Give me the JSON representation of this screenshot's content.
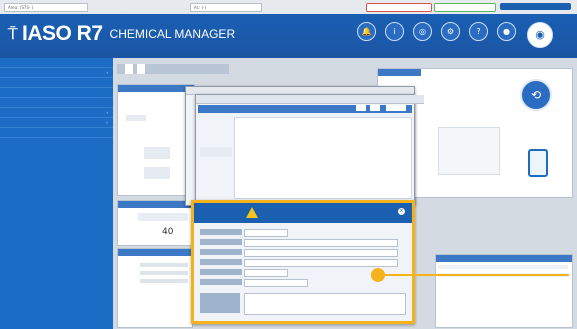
{
  "topbar": {
    "left_field": "Area: (STS- )",
    "middle_field": "Ac: (-)",
    "right_pill_1": "",
    "right_pill_2": "",
    "right_button": ""
  },
  "header": {
    "brand": "IASO R7",
    "product": "CHEMICAL MANAGER",
    "icons": [
      {
        "name": "notification-icon",
        "label": "",
        "glyph": "🔔"
      },
      {
        "name": "info-icon",
        "label": "",
        "glyph": "i"
      },
      {
        "name": "globe-icon",
        "label": "",
        "glyph": "◎"
      },
      {
        "name": "settings-icon",
        "label": "",
        "glyph": "⚙"
      },
      {
        "name": "help-icon",
        "label": "",
        "glyph": "?"
      },
      {
        "name": "user-icon",
        "label": "",
        "glyph": "●"
      }
    ]
  },
  "sidebar": {
    "items": [
      {
        "label": "",
        "has_arrow": false
      },
      {
        "label": "",
        "has_arrow": true
      },
      {
        "label": "",
        "has_arrow": false
      },
      {
        "label": "",
        "has_arrow": false
      },
      {
        "label": "",
        "has_arrow": false
      },
      {
        "label": "",
        "has_arrow": true
      },
      {
        "label": "",
        "has_arrow": true
      },
      {
        "label": "",
        "has_arrow": false
      }
    ]
  },
  "main": {
    "left_panel_title": "",
    "middle_value": "40",
    "right_panel_title": ""
  },
  "dialog": {
    "title": "",
    "warning_text": "",
    "field_labels": [
      "",
      "",
      "",
      "",
      "",
      ""
    ],
    "field_values": [
      "",
      "",
      "",
      "",
      "",
      ""
    ]
  },
  "colors": {
    "brand_blue": "#1b5fb0",
    "highlight": "#f5b21b"
  }
}
